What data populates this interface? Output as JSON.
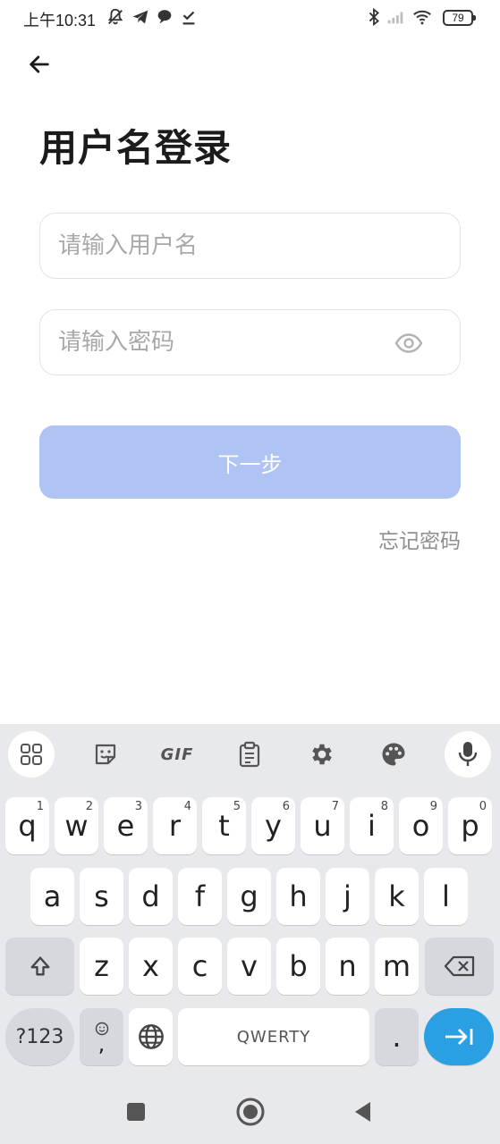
{
  "status_bar": {
    "time": "上午10:31",
    "battery": "79"
  },
  "header": {
    "title": "用户名登录"
  },
  "form": {
    "username_placeholder": "请输入用户名",
    "username_value": "",
    "password_placeholder": "请输入密码",
    "password_value": "",
    "next_label": "下一步",
    "forgot_label": "忘记密码"
  },
  "keyboard": {
    "toolbar": {
      "gif_label": "GIF"
    },
    "row1": [
      {
        "key": "q",
        "hint": "1"
      },
      {
        "key": "w",
        "hint": "2"
      },
      {
        "key": "e",
        "hint": "3"
      },
      {
        "key": "r",
        "hint": "4"
      },
      {
        "key": "t",
        "hint": "5"
      },
      {
        "key": "y",
        "hint": "6"
      },
      {
        "key": "u",
        "hint": "7"
      },
      {
        "key": "i",
        "hint": "8"
      },
      {
        "key": "o",
        "hint": "9"
      },
      {
        "key": "p",
        "hint": "0"
      }
    ],
    "row2": [
      "a",
      "s",
      "d",
      "f",
      "g",
      "h",
      "j",
      "k",
      "l"
    ],
    "row3": [
      "z",
      "x",
      "c",
      "v",
      "b",
      "n",
      "m"
    ],
    "symbols_label": "?123",
    "comma_label": ",",
    "space_label": "QWERTY",
    "period_label": "."
  },
  "colors": {
    "accent_disabled": "#b0c4f4",
    "enter_key": "#2a9fe2",
    "keyboard_bg": "#e8e9ec"
  }
}
